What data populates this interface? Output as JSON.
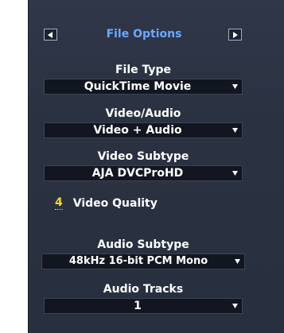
{
  "header": {
    "title": "File Options",
    "prev_icon": "left-arrow-icon",
    "next_icon": "right-arrow-icon"
  },
  "file_type": {
    "label": "File Type",
    "value": "QuickTime Movie"
  },
  "video_audio": {
    "label": "Video/Audio",
    "value": "Video + Audio"
  },
  "video_subtype": {
    "label": "Video Subtype",
    "value": "AJA DVCProHD"
  },
  "video_quality": {
    "value": "4",
    "label": "Video Quality"
  },
  "audio_subtype": {
    "label": "Audio Subtype",
    "value": "48kHz 16-bit PCM Mono"
  },
  "audio_tracks": {
    "label": "Audio Tracks",
    "value": "1"
  },
  "colors": {
    "panel_background": "#2c3344",
    "title_accent": "#6ea8ff",
    "quality_accent": "#ffd62a",
    "dropdown_background": "#121620"
  }
}
